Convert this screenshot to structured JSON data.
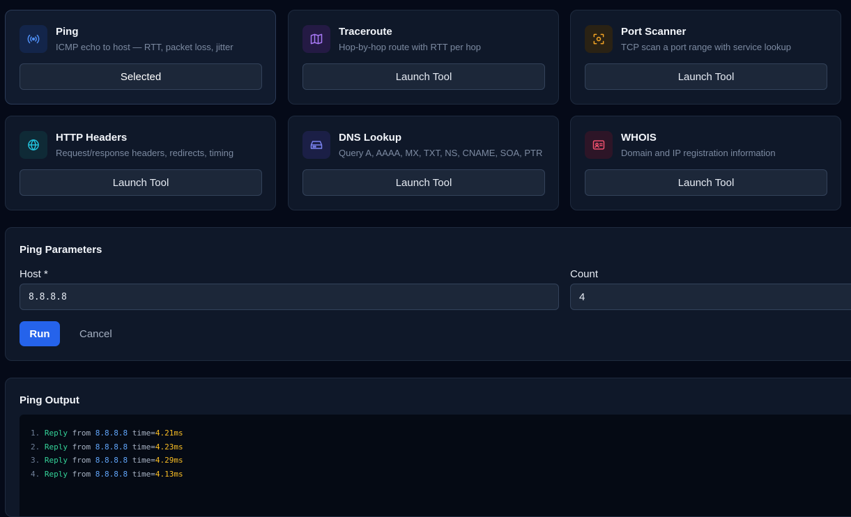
{
  "tools": [
    {
      "name": "Ping",
      "description": "ICMP echo to host — RTT, packet loss, jitter",
      "button": "Selected",
      "icon": "signal-icon",
      "color": "#3b82f6"
    },
    {
      "name": "Traceroute",
      "description": "Hop-by-hop route with RTT per hop",
      "button": "Launch Tool",
      "icon": "map-icon",
      "color": "#a855f7"
    },
    {
      "name": "Port Scanner",
      "description": "TCP scan a port range with service lookup",
      "button": "Launch Tool",
      "icon": "scan-icon",
      "color": "#f59e0b"
    },
    {
      "name": "HTTP Headers",
      "description": "Request/response headers, redirects, timing",
      "button": "Launch Tool",
      "icon": "globe-icon",
      "color": "#06b6d4"
    },
    {
      "name": "DNS Lookup",
      "description": "Query A, AAAA, MX, TXT, NS, CNAME, SOA, PTR",
      "button": "Launch Tool",
      "icon": "server-icon",
      "color": "#6366f1"
    },
    {
      "name": "WHOIS",
      "description": "Domain and IP registration information",
      "button": "Launch Tool",
      "icon": "id-card-icon",
      "color": "#f43f5e"
    }
  ],
  "params": {
    "title": "Ping Parameters",
    "host_label": "Host *",
    "host_value": "8.8.8.8",
    "count_label": "Count",
    "count_value": "4",
    "run_label": "Run",
    "cancel_label": "Cancel"
  },
  "output": {
    "title": "Ping Output",
    "lines": [
      {
        "n": "1.",
        "status": "Reply",
        "from": "from",
        "host": "8.8.8.8",
        "time_label": "time=",
        "time": "4.21ms"
      },
      {
        "n": "2.",
        "status": "Reply",
        "from": "from",
        "host": "8.8.8.8",
        "time_label": "time=",
        "time": "4.23ms"
      },
      {
        "n": "3.",
        "status": "Reply",
        "from": "from",
        "host": "8.8.8.8",
        "time_label": "time=",
        "time": "4.29ms"
      },
      {
        "n": "4.",
        "status": "Reply",
        "from": "from",
        "host": "8.8.8.8",
        "time_label": "time=",
        "time": "4.13ms"
      }
    ]
  }
}
